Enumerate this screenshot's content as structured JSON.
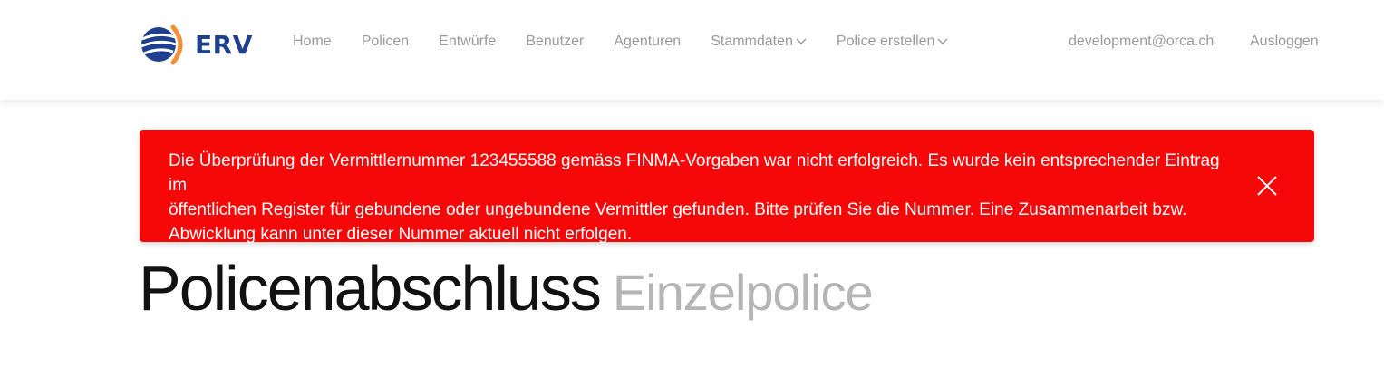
{
  "header": {
    "logo_text": "ERV",
    "nav": [
      {
        "label": "Home",
        "dropdown": false
      },
      {
        "label": "Policen",
        "dropdown": false
      },
      {
        "label": "Entwürfe",
        "dropdown": false
      },
      {
        "label": "Benutzer",
        "dropdown": false
      },
      {
        "label": "Agenturen",
        "dropdown": false
      },
      {
        "label": "Stammdaten",
        "dropdown": true
      },
      {
        "label": "Police erstellen",
        "dropdown": true
      }
    ],
    "user_email": "development@orca.ch",
    "logout_label": "Ausloggen"
  },
  "alert": {
    "lines": [
      "Die Überprüfung der Vermittlernummer 123455588 gemäss FINMA-Vorgaben war nicht erfolgreich. Es wurde kein entsprechender Eintrag im",
      "öffentlichen Register für gebundene oder ungebundene Vermittler gefunden. Bitte prüfen Sie die Nummer. Eine Zusammenarbeit bzw.",
      "Abwicklung kann unter dieser Nummer aktuell nicht erfolgen."
    ],
    "close_icon": "close-icon",
    "background_color": "#f70808"
  },
  "page": {
    "title": "Policenabschluss",
    "subtitle": "Einzelpolice"
  },
  "colors": {
    "brand_blue": "#1f3f8f",
    "brand_orange": "#f0913a",
    "nav_text": "#9a9a9a",
    "alert_red": "#f70808"
  }
}
